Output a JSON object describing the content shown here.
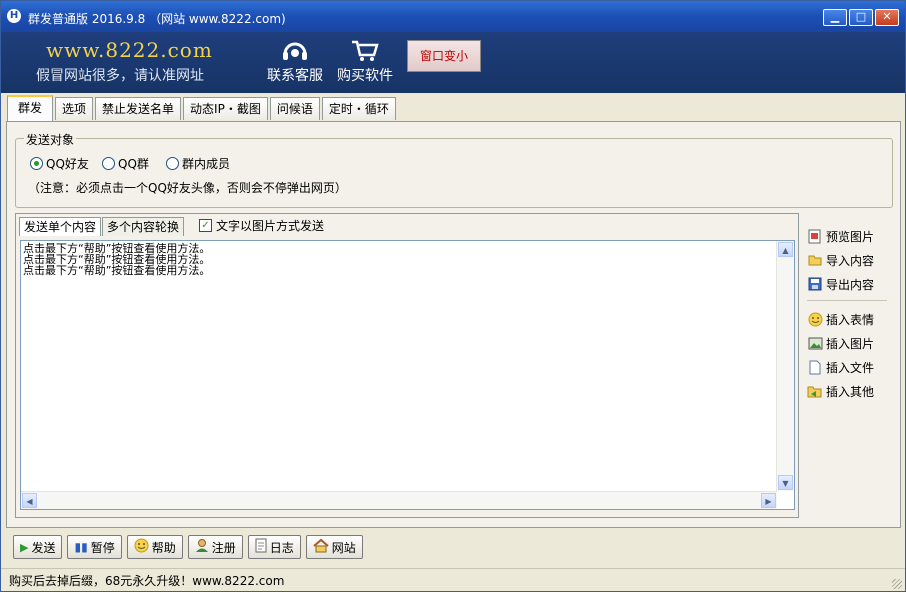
{
  "window": {
    "title": "群发普通版 2016.9.8 （网站 www.8222.com)",
    "controls": {
      "minimize": "▁",
      "maximize": "□",
      "close": "✕"
    }
  },
  "banner": {
    "site": "www.8222.com",
    "slogan": "假冒网站很多，请认准网址",
    "service_label": "联系客服",
    "buy_label": "购买软件",
    "shrink_label": "窗口变小"
  },
  "tabs": [
    "群发",
    "选项",
    "禁止发送名单",
    "动态IP・截图",
    "问候语",
    "定时・循环"
  ],
  "target_group": {
    "title": "发送对象",
    "options": [
      "QQ好友",
      "QQ群",
      "群内成员"
    ],
    "selected": "QQ好友",
    "note": "（注意：必须点击一个QQ好友头像，否则会不停弹出网页）"
  },
  "content": {
    "tabs": [
      "发送单个内容",
      "多个内容轮换"
    ],
    "image_send_label": "文字以图片方式发送",
    "image_send_checked": true,
    "lines": [
      "点击最下方“帮助”按钮查看使用方法。",
      "点击最下方“帮助”按钮查看使用方法。",
      "点击最下方“帮助”按钮查看使用方法。"
    ]
  },
  "side_actions": {
    "preview": "预览图片",
    "import": "导入内容",
    "export": "导出内容",
    "insert_emoji": "插入表情",
    "insert_image": "插入图片",
    "insert_file": "插入文件",
    "insert_other": "插入其他"
  },
  "buttons": {
    "send": "发送",
    "pause": "暂停",
    "help": "帮助",
    "register": "注册",
    "log": "日志",
    "website": "网站"
  },
  "status": "购买后去掉后缀，68元永久升级！www.8222.com",
  "colors": {
    "banner": "#1f3e7c",
    "site_url": "#f4d34a",
    "shrink_text": "#c00000",
    "active_tab": "#ffc83c"
  }
}
